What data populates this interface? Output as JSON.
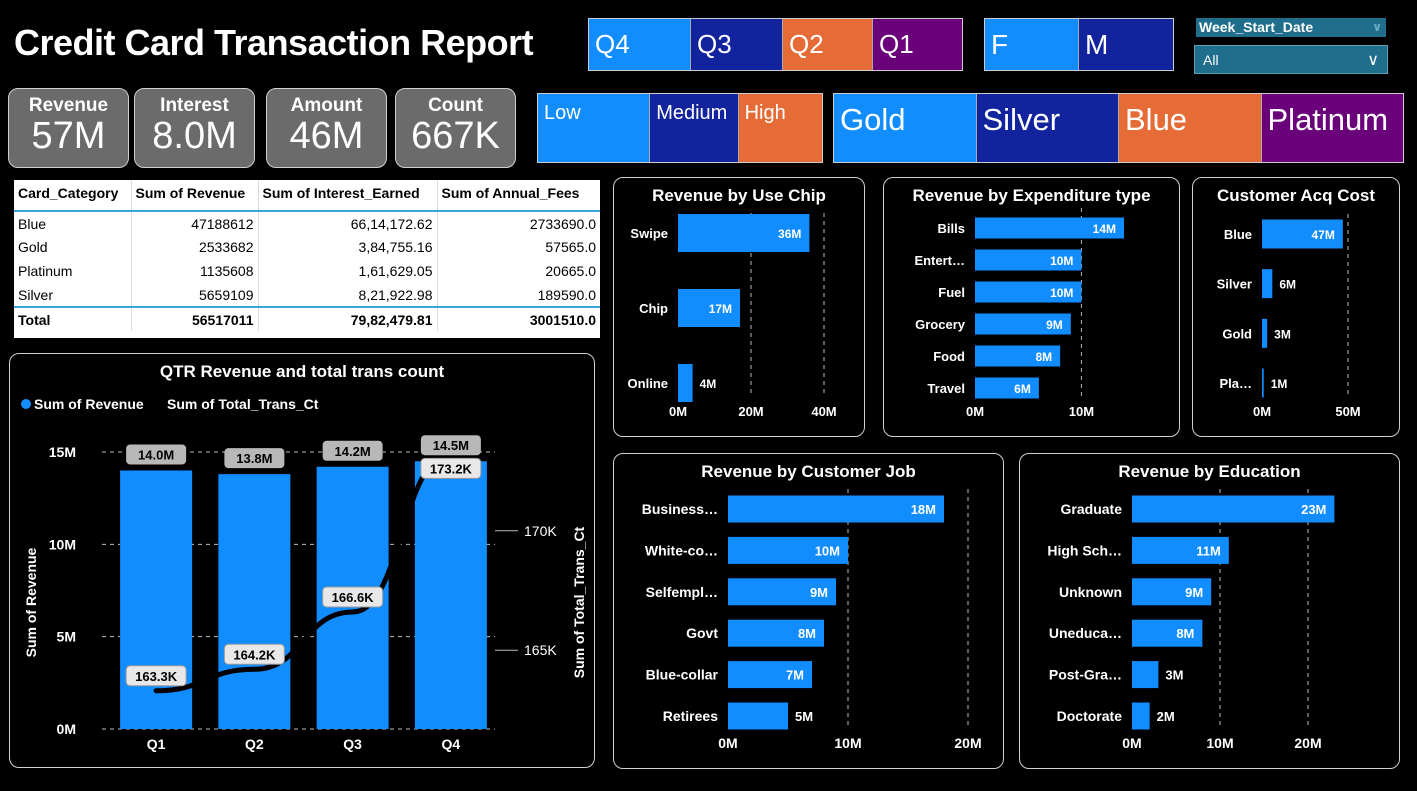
{
  "title": "Credit Card Transaction Report",
  "colors": {
    "bar": "#118dff",
    "navy": "#12239e",
    "orange": "#e66c37",
    "purple": "#6b007b",
    "grey": "#6b6b6b"
  },
  "quarter_slicer": [
    {
      "label": "Q4",
      "color": "#118dff"
    },
    {
      "label": "Q3",
      "color": "#12239e"
    },
    {
      "label": "Q2",
      "color": "#e66c37"
    },
    {
      "label": "Q1",
      "color": "#6b007b"
    }
  ],
  "gender_slicer": [
    {
      "label": "F",
      "color": "#118dff"
    },
    {
      "label": "M",
      "color": "#12239e"
    }
  ],
  "week_filter": {
    "label": "Week_Start_Date",
    "value": "All"
  },
  "income_slicer": [
    {
      "label": "Low",
      "color": "#118dff"
    },
    {
      "label": "Medium",
      "color": "#12239e"
    },
    {
      "label": "High",
      "color": "#e66c37"
    }
  ],
  "card_slicer": [
    {
      "label": "Gold",
      "color": "#118dff"
    },
    {
      "label": "Silver",
      "color": "#12239e"
    },
    {
      "label": "Blue",
      "color": "#e66c37"
    },
    {
      "label": "Platinum",
      "color": "#6b007b"
    }
  ],
  "kpis": [
    {
      "label": "Revenue",
      "value": "57M"
    },
    {
      "label": "Interest",
      "value": "8.0M"
    },
    {
      "label": "Amount",
      "value": "46M"
    },
    {
      "label": "Count",
      "value": "667K"
    }
  ],
  "matrix": {
    "headers": [
      "Card_Category",
      "Sum of Revenue",
      "Sum of Interest_Earned",
      "Sum of Annual_Fees"
    ],
    "rows": [
      [
        "Blue",
        "47188612",
        "66,14,172.62",
        "2733690.0"
      ],
      [
        "Gold",
        "2533682",
        "3,84,755.16",
        "57565.0"
      ],
      [
        "Platinum",
        "1135608",
        "1,61,629.05",
        "20665.0"
      ],
      [
        "Silver",
        "5659109",
        "8,21,922.98",
        "189590.0"
      ]
    ],
    "total": [
      "Total",
      "56517011",
      "79,82,479.81",
      "3001510.0"
    ]
  },
  "chart_data": [
    {
      "id": "qtr",
      "type": "bar",
      "title": "QTR Revenue and total trans count",
      "categories": [
        "Q1",
        "Q2",
        "Q3",
        "Q4"
      ],
      "series": [
        {
          "name": "Sum of Revenue",
          "type": "bar",
          "values": [
            14.0,
            13.8,
            14.2,
            14.5
          ],
          "labels": [
            "14.0M",
            "13.8M",
            "14.2M",
            "14.5M"
          ]
        },
        {
          "name": "Sum of Total_Trans_Ct",
          "type": "line",
          "values": [
            163.3,
            164.2,
            166.6,
            173.2
          ],
          "labels": [
            "163.3K",
            "164.2K",
            "166.6K",
            "173.2K"
          ]
        }
      ],
      "ylabel": "Sum of Revenue",
      "y2label": "Sum of Total_Trans_Ct",
      "yticks": [
        "15M",
        "10M",
        "5M",
        "0M"
      ],
      "y2ticks": [
        "170K",
        "165K"
      ],
      "ylim": [
        0,
        15
      ],
      "y2lim": [
        161.7,
        173.3
      ],
      "legend": "top-left"
    },
    {
      "id": "chip",
      "type": "bar",
      "orientation": "horizontal",
      "title": "Revenue by Use Chip",
      "categories": [
        "Swipe",
        "Chip",
        "Online"
      ],
      "values": [
        36,
        17,
        4
      ],
      "labels": [
        "36M",
        "17M",
        "4M"
      ],
      "xticks": [
        "0M",
        "20M",
        "40M"
      ],
      "xlim": [
        0,
        40
      ]
    },
    {
      "id": "exp",
      "type": "bar",
      "orientation": "horizontal",
      "title": "Revenue by Expenditure type",
      "categories": [
        "Bills",
        "Entert…",
        "Fuel",
        "Grocery",
        "Food",
        "Travel"
      ],
      "values": [
        14,
        10,
        10,
        9,
        8,
        6
      ],
      "labels": [
        "14M",
        "10M",
        "10M",
        "9M",
        "8M",
        "6M"
      ],
      "xticks": [
        "0M",
        "10M"
      ],
      "xlim": [
        0,
        14
      ]
    },
    {
      "id": "acq",
      "type": "bar",
      "orientation": "horizontal",
      "title": "Customer Acq Cost",
      "categories": [
        "Blue",
        "Silver",
        "Gold",
        "Pla…"
      ],
      "values": [
        47,
        6,
        3,
        1
      ],
      "labels": [
        "47M",
        "6M",
        "3M",
        "1M"
      ],
      "xticks": [
        "0M",
        "50M"
      ],
      "xlim": [
        0,
        50
      ]
    },
    {
      "id": "job",
      "type": "bar",
      "orientation": "horizontal",
      "title": "Revenue by Customer Job",
      "categories": [
        "Business…",
        "White-co…",
        "Selfempl…",
        "Govt",
        "Blue-collar",
        "Retirees"
      ],
      "values": [
        18,
        10,
        9,
        8,
        7,
        5
      ],
      "labels": [
        "18M",
        "10M",
        "9M",
        "8M",
        "7M",
        "5M"
      ],
      "xticks": [
        "0M",
        "10M",
        "20M"
      ],
      "xlim": [
        0,
        20
      ]
    },
    {
      "id": "edu",
      "type": "bar",
      "orientation": "horizontal",
      "title": "Revenue by Education",
      "categories": [
        "Graduate",
        "High Sch…",
        "Unknown",
        "Uneduca…",
        "Post-Gra…",
        "Doctorate"
      ],
      "values": [
        23,
        11,
        9,
        8,
        3,
        2
      ],
      "labels": [
        "23M",
        "11M",
        "9M",
        "8M",
        "3M",
        "2M"
      ],
      "xticks": [
        "0M",
        "10M",
        "20M"
      ],
      "xlim": [
        0,
        20
      ]
    }
  ]
}
